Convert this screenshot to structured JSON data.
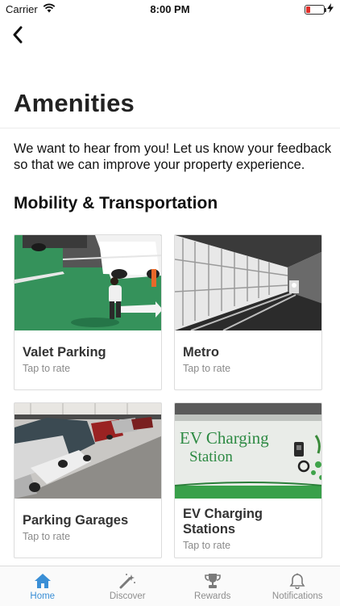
{
  "status": {
    "carrier": "Carrier",
    "time": "8:00 PM"
  },
  "page": {
    "title": "Amenities",
    "intro": "We want to hear from you! Let us know your feedback so that we can improve your property experience.",
    "section_title": "Mobility & Transportation"
  },
  "cards": [
    {
      "title": "Valet Parking",
      "subtitle": "Tap to rate"
    },
    {
      "title": "Metro",
      "subtitle": "Tap to rate"
    },
    {
      "title": "Parking Garages",
      "subtitle": "Tap to rate"
    },
    {
      "title": "EV Charging Stations",
      "subtitle": "Tap to rate",
      "sign_text_1": "EV Charging",
      "sign_text_2": "Station"
    }
  ],
  "tabs": [
    {
      "label": "Home",
      "icon": "home-icon",
      "active": true
    },
    {
      "label": "Discover",
      "icon": "magic-wand-icon"
    },
    {
      "label": "Rewards",
      "icon": "trophy-icon"
    },
    {
      "label": "Notifications",
      "icon": "bell-icon"
    }
  ],
  "colors": {
    "accent": "#3a8fd6",
    "battery_low": "#e0302a"
  }
}
